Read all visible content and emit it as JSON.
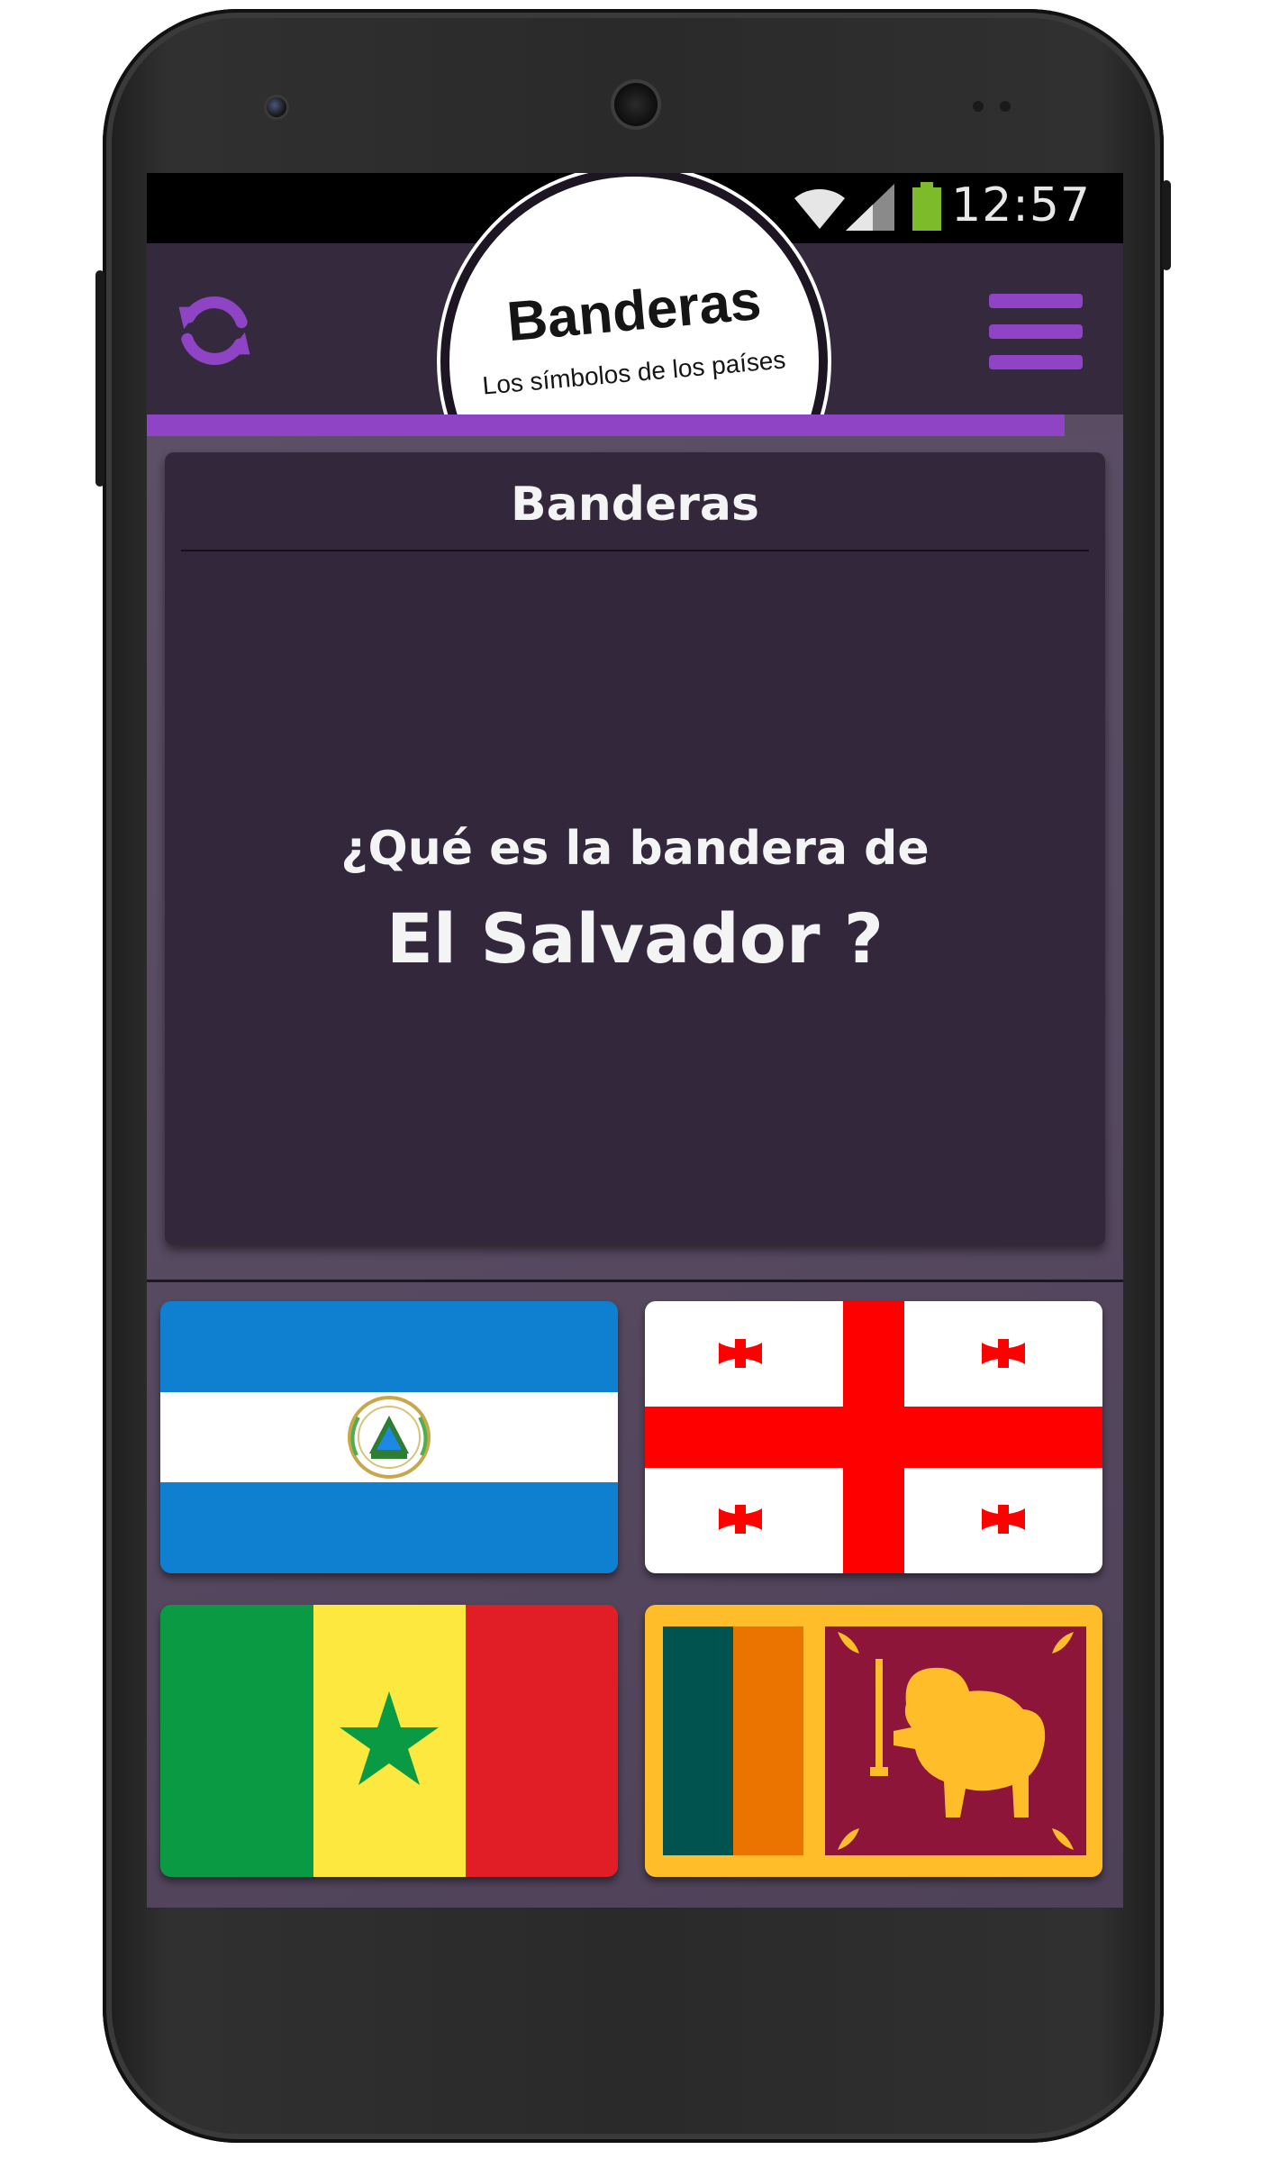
{
  "status_bar": {
    "time": "12:57",
    "icons": [
      "wifi-icon",
      "signal-icon",
      "battery-icon"
    ]
  },
  "header": {
    "logo_title": "Banderas",
    "logo_subtitle": "Los símbolos de los países",
    "refresh_icon": "refresh-icon",
    "menu_icon": "hamburger-menu-icon",
    "progress_fraction": 0.94
  },
  "card": {
    "title": "Banderas",
    "question": "¿Qué es la bandera de",
    "country": "El Salvador ?"
  },
  "options": [
    {
      "flag": "el-salvador-flag"
    },
    {
      "flag": "georgia-flag"
    },
    {
      "flag": "senegal-flag"
    },
    {
      "flag": "sri-lanka-flag"
    }
  ],
  "colors": {
    "accent": "#8e44c4",
    "header_bg": "#35293d",
    "card_bg": "#33283b",
    "screen_bg": "#5b4e64"
  }
}
